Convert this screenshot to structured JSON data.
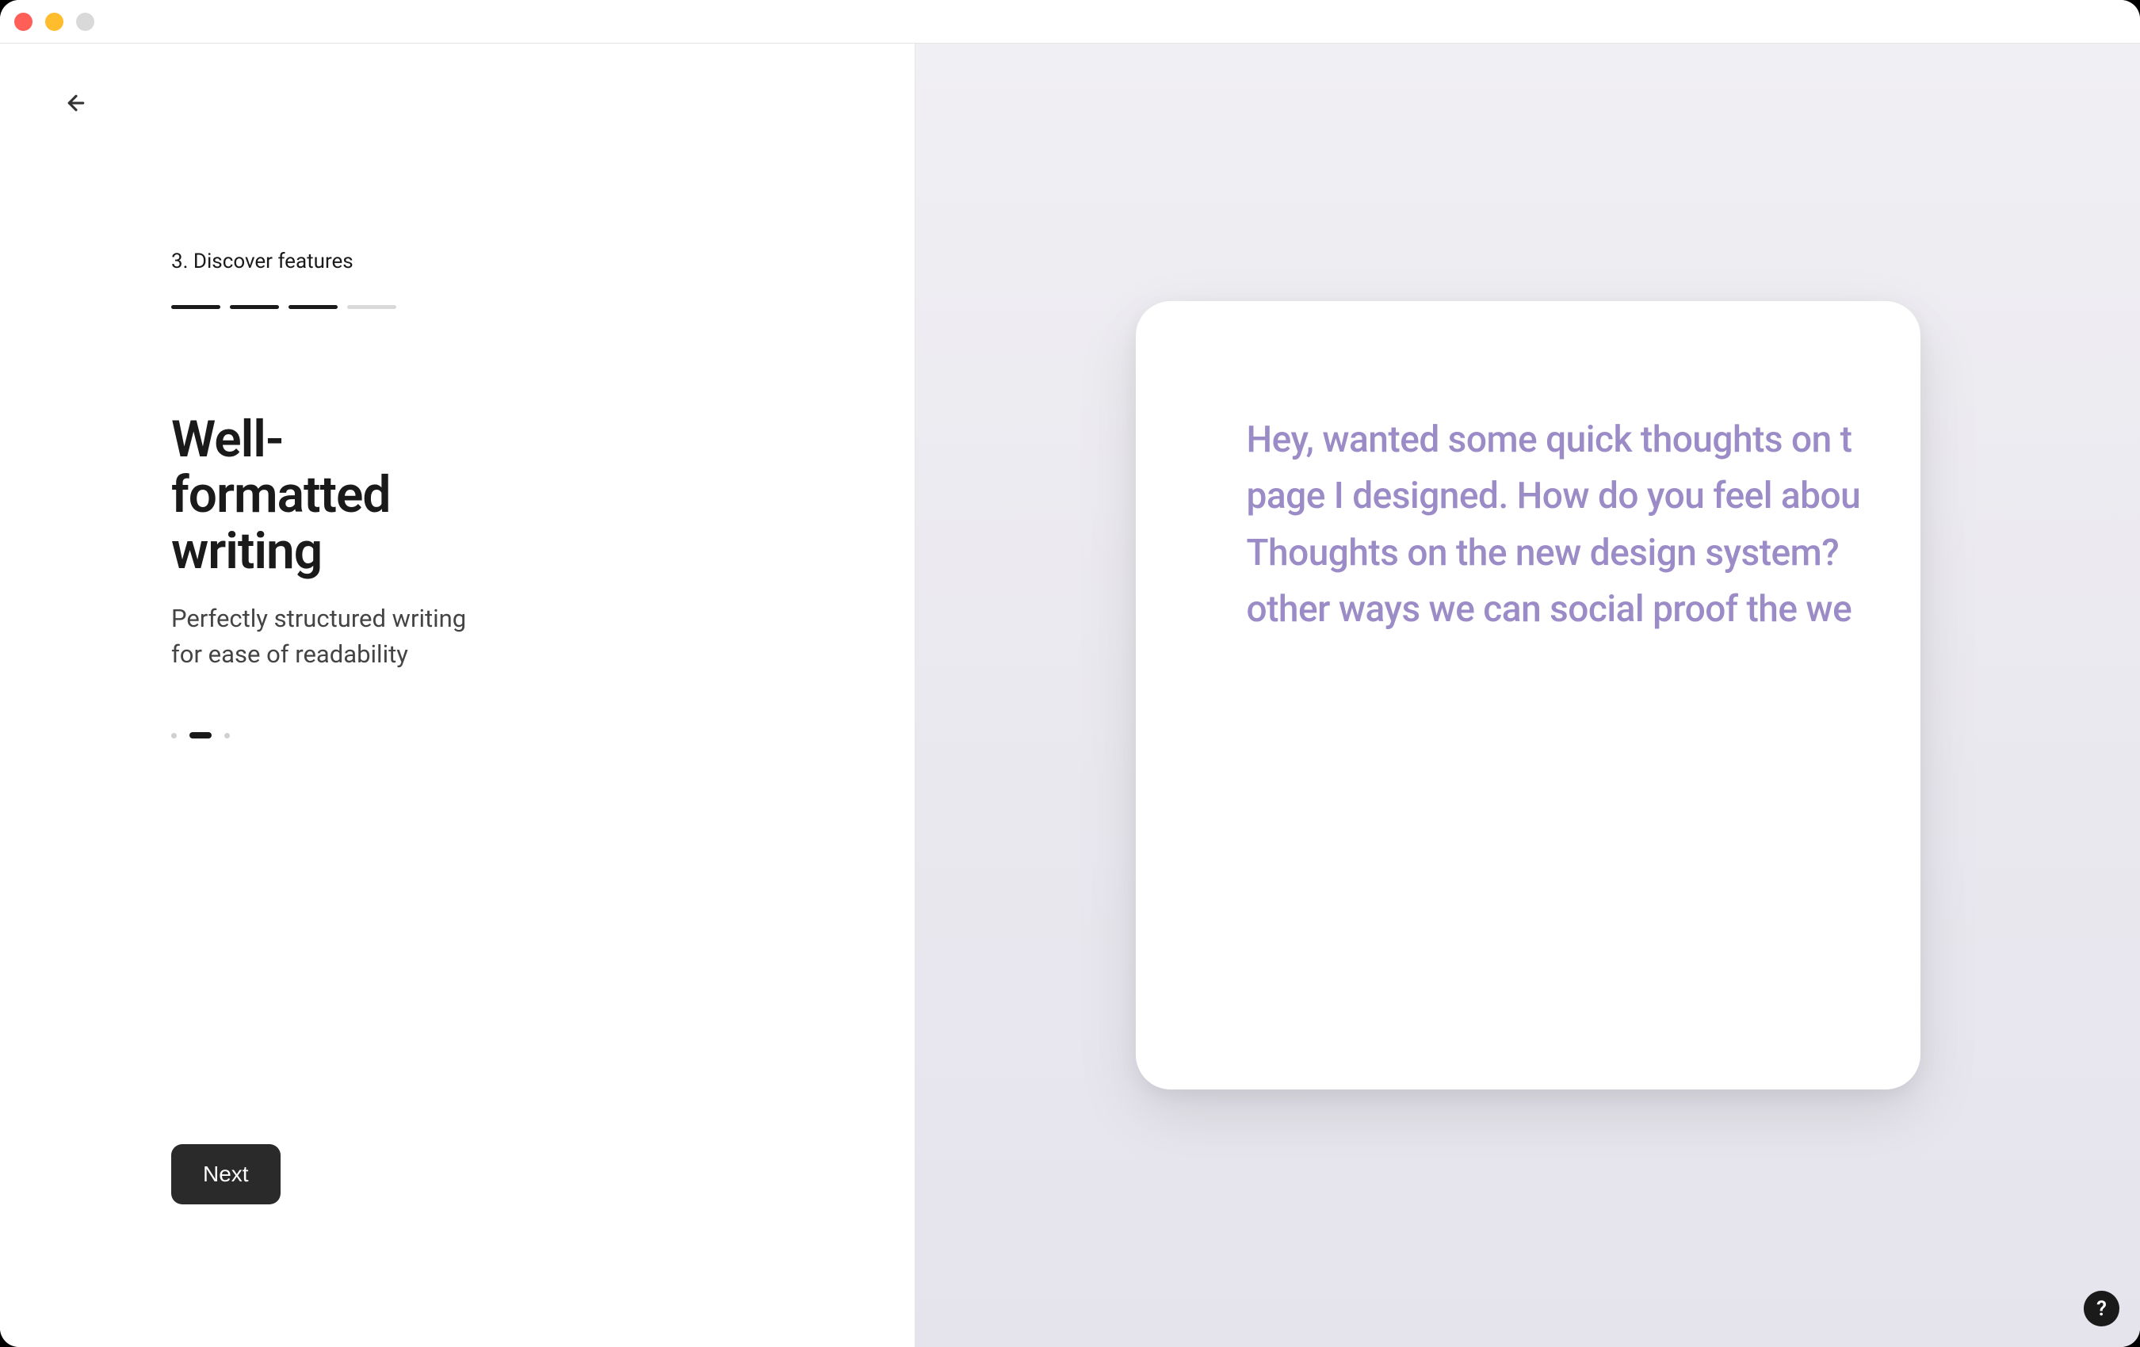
{
  "step": {
    "label": "3. Discover features",
    "progress": {
      "total": 4,
      "completed": 3
    }
  },
  "feature": {
    "headline": "Well-formatted writing",
    "subtext": "Perfectly structured writing for ease of readability"
  },
  "carousel": {
    "total": 3,
    "active_index": 1
  },
  "buttons": {
    "next_label": "Next",
    "help_label": "?"
  },
  "preview": {
    "lines": [
      "Hey, wanted some quick thoughts on t",
      "page I designed. How do you feel abou",
      "Thoughts on the new design system?",
      "other ways we can social proof the we"
    ]
  },
  "colors": {
    "accent_text": "#9b8cc7",
    "button_bg": "#2a2a2a",
    "panel_gradient_start": "#f0eff3",
    "panel_gradient_end": "#e5e3ec"
  }
}
